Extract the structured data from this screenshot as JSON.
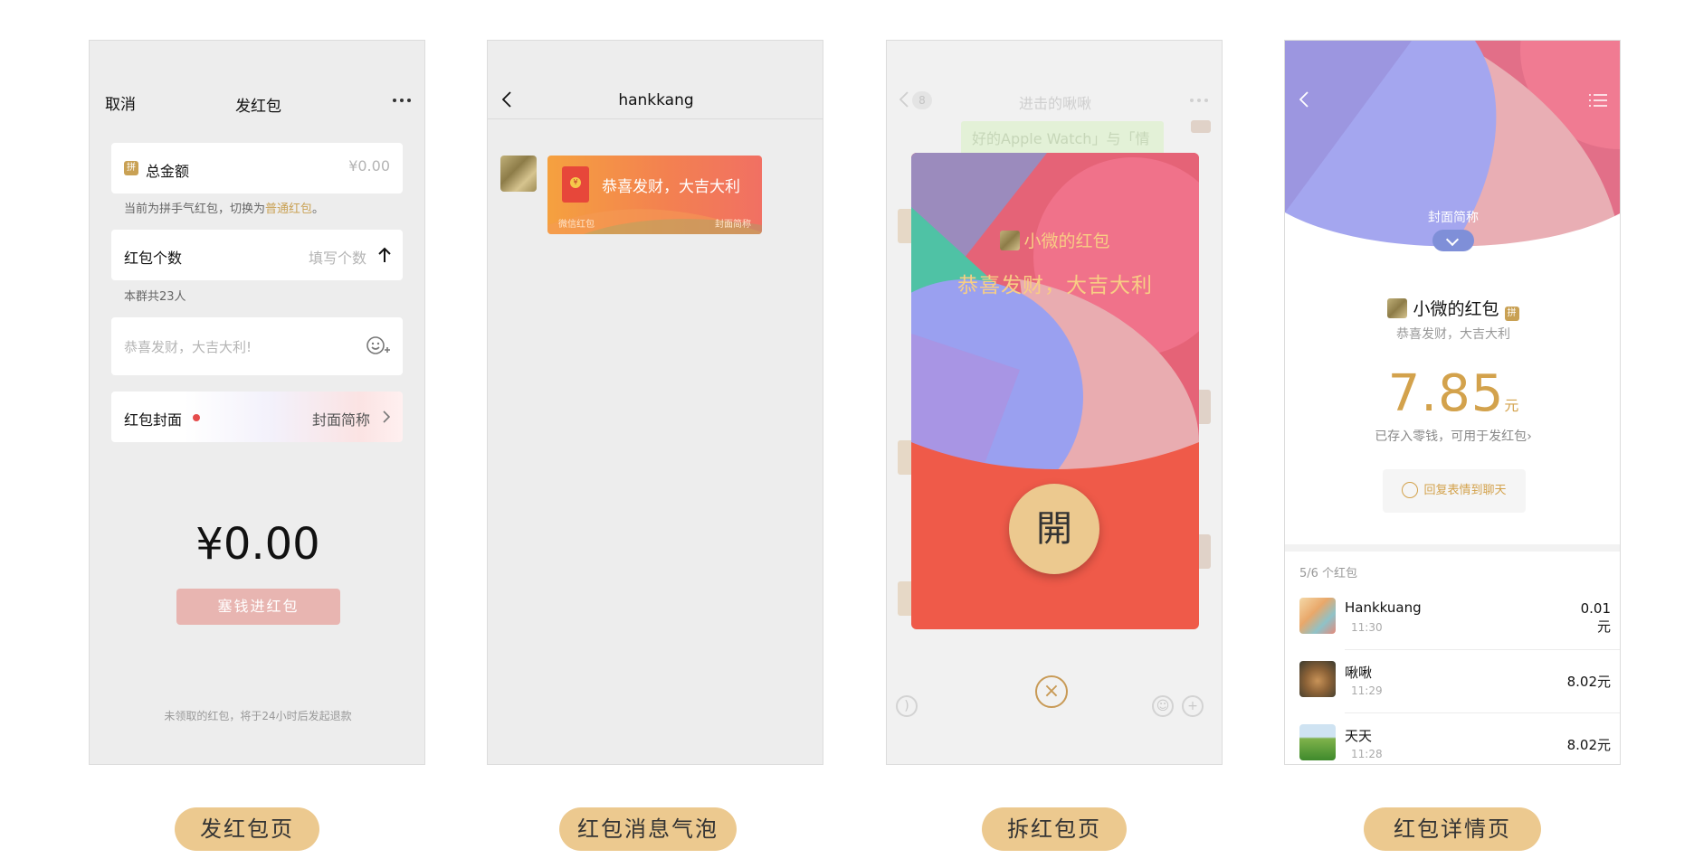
{
  "captions": [
    "发红包页",
    "红包消息气泡",
    "拆红包页",
    "红包详情页"
  ],
  "send_page": {
    "cancel": "取消",
    "title": "发红包",
    "total_label": "总金额",
    "pin_badge": "拼",
    "total_value": "¥0.00",
    "mode_hint": "当前为拼手气红包，切换为",
    "mode_link": "普通红包",
    "mode_hint_end": "。",
    "count_label": "红包个数",
    "count_placeholder": "填写个数",
    "group_hint": "本群共23人",
    "wish_placeholder": "恭喜发财，大吉大利!",
    "cover_label": "红包封面",
    "cover_value": "封面简称",
    "amount": "¥0.00",
    "submit": "塞钱进红包",
    "refund_note": "未领取的红包，将于24小时后发起退款"
  },
  "bubble_page": {
    "title": "hankkang",
    "wish": "恭喜发财，大吉大利",
    "coin_glyph": "¥",
    "footer_left": "微信红包",
    "footer_right": "封面简称"
  },
  "open_page": {
    "ghost_title": "进击的啾啾",
    "ghost_badge": "8",
    "ghost_msg": "好的Apple Watch」与「情",
    "from": "小微的红包",
    "wish": "恭喜发财，大吉大利",
    "open_glyph": "開",
    "close_glyph": "×"
  },
  "detail_page": {
    "cover_name": "封面简称",
    "sender": "小微的红包",
    "pin_badge": "拼",
    "wish": "恭喜发财，大吉大利",
    "amount": "7.85",
    "unit": "元",
    "stored_note": "已存入零钱，可用于发红包",
    "reply_button": "回复表情到聊天",
    "count_summary": "5/6 个红包",
    "records": [
      {
        "name": "Hankkuang",
        "time": "11:30",
        "amount": "0.01",
        "unit": "元"
      },
      {
        "name": "啾啾",
        "time": "11:29",
        "amount": "8.02元"
      },
      {
        "name": "天天",
        "time": "11:28",
        "amount": "8.02元"
      }
    ]
  },
  "colors": {
    "caption_bg": "#ecc98f",
    "accent_gold": "#d3a24c",
    "red_envelope": "#ef5a49",
    "link": "#c9a154"
  }
}
